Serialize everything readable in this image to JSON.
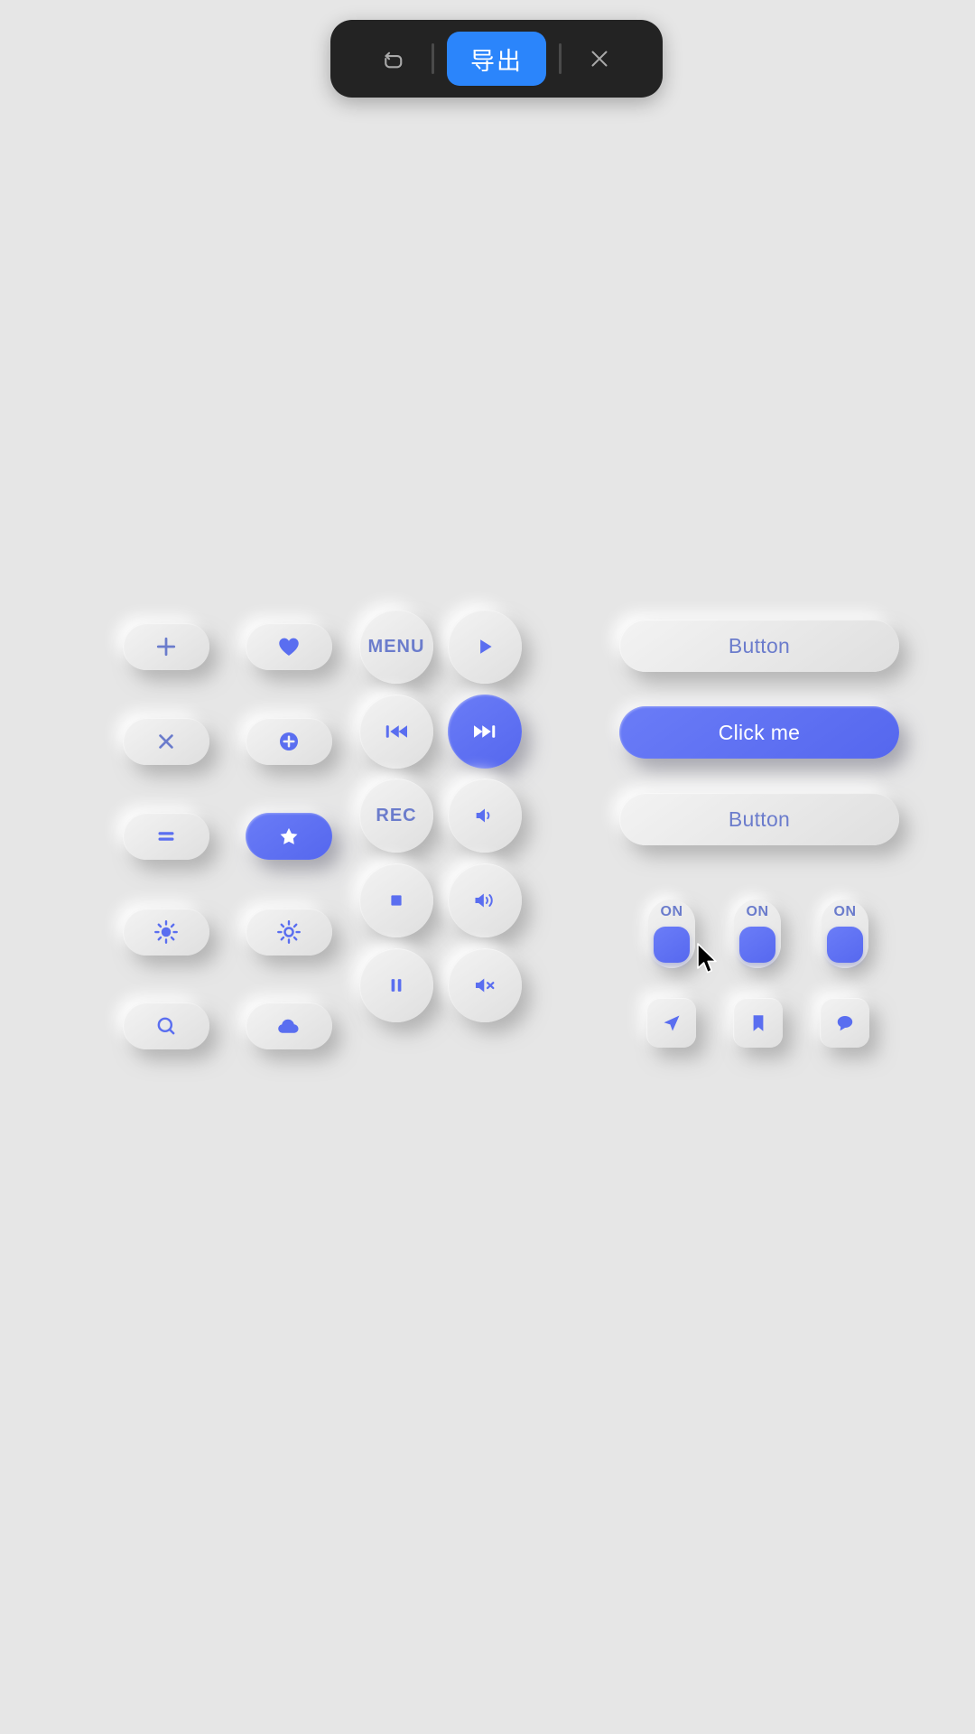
{
  "toolbar": {
    "undo_label": "undo",
    "export_label": "导出",
    "close_label": "close"
  },
  "grid_left": {
    "rows": [
      [
        {
          "icon": "plus-icon",
          "active": false
        },
        {
          "icon": "heart-icon",
          "active": false
        }
      ],
      [
        {
          "icon": "close-x-icon",
          "active": false
        },
        {
          "icon": "plus-circle-icon",
          "active": false
        }
      ],
      [
        {
          "icon": "equals-icon",
          "active": false
        },
        {
          "icon": "star-icon",
          "active": true
        }
      ],
      [
        {
          "icon": "sun-filled-icon",
          "active": false
        },
        {
          "icon": "sun-outline-icon",
          "active": false
        }
      ],
      [
        {
          "icon": "search-icon",
          "active": false
        },
        {
          "icon": "cloud-icon",
          "active": false
        }
      ]
    ]
  },
  "grid_media": {
    "rows": [
      [
        {
          "label": "MENU",
          "icon": "text-label",
          "active": false
        },
        {
          "label": "",
          "icon": "play-icon",
          "active": false
        }
      ],
      [
        {
          "label": "",
          "icon": "previous-track-icon",
          "active": false
        },
        {
          "label": "",
          "icon": "next-track-icon",
          "active": true
        }
      ],
      [
        {
          "label": "REC",
          "icon": "text-label",
          "active": false
        },
        {
          "label": "",
          "icon": "volume-low-icon",
          "active": false
        }
      ],
      [
        {
          "label": "",
          "icon": "stop-icon",
          "active": false
        },
        {
          "label": "",
          "icon": "volume-high-icon",
          "active": false
        }
      ],
      [
        {
          "label": "",
          "icon": "pause-icon",
          "active": false
        },
        {
          "label": "",
          "icon": "volume-mute-icon",
          "active": false
        }
      ]
    ]
  },
  "wide_buttons": [
    {
      "label": "Button",
      "active": false
    },
    {
      "label": "Click me",
      "active": true
    },
    {
      "label": "Button",
      "active": false
    }
  ],
  "toggles": [
    {
      "label": "ON",
      "state": "on"
    },
    {
      "label": "ON",
      "state": "on"
    },
    {
      "label": "ON",
      "state": "on"
    }
  ],
  "square_buttons": [
    {
      "icon": "send-icon"
    },
    {
      "icon": "bookmark-icon"
    },
    {
      "icon": "chat-bubble-icon"
    }
  ],
  "colors": {
    "background": "#e6e6e6",
    "accent_blue": "#5a6ef0",
    "accent_button_blue": "#5a7bfc",
    "toolbar_bg": "#232323",
    "toolbar_accent": "#2b85fb",
    "icon_blue": "#6b7ccc"
  }
}
